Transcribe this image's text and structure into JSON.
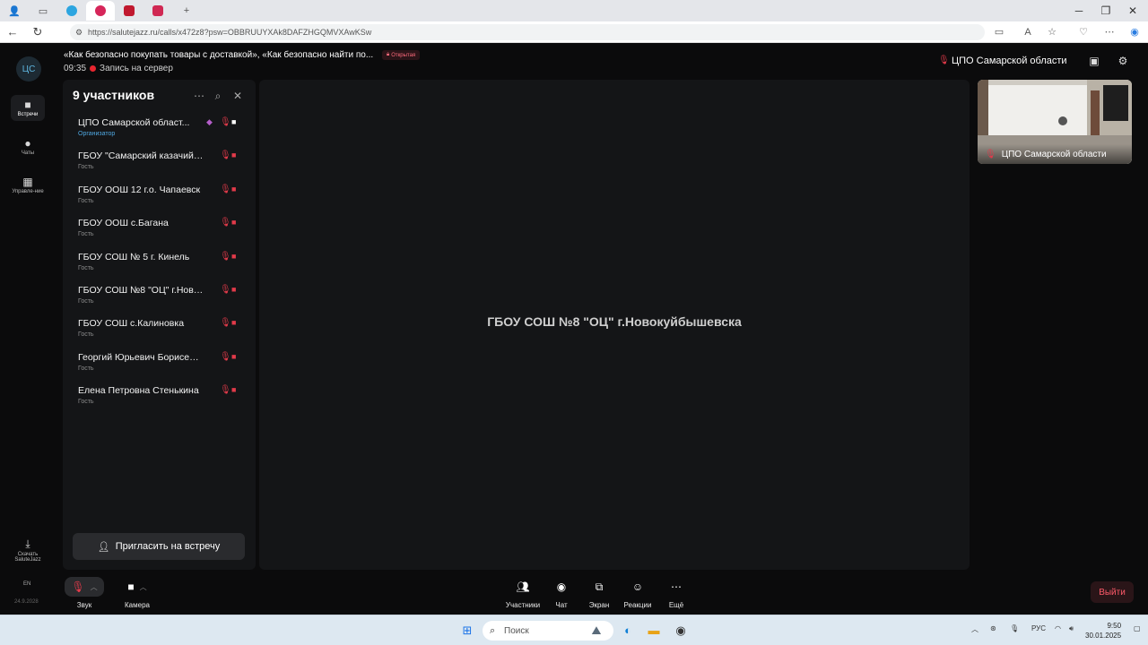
{
  "browser": {
    "url": "https://salutejazz.ru/calls/x472z8?psw=OBBRUUYXAk8DAFZHGQMVXAwKSw"
  },
  "header": {
    "avatar_initials": "ЦС",
    "meeting_title": "«Как безопасно покупать товары с доставкой», «Как безопасно найти по...",
    "open_badge": "Открытая",
    "time": "09:35",
    "recording": "Запись на сервер",
    "organizer_name": "ЦПО Самарской области"
  },
  "rail": {
    "items": [
      {
        "label": "Встречи",
        "icon": "camera-icon",
        "active": true
      },
      {
        "label": "Чаты",
        "icon": "chat-icon",
        "active": false
      },
      {
        "label": "Управле-ние",
        "icon": "chart-icon",
        "active": false
      }
    ],
    "download_label": "Скачать SaluteJazz",
    "lang": "EN",
    "version_date": "24.9.2028"
  },
  "participants": {
    "title": "9 участников",
    "list": [
      {
        "name": "ЦПО Самарской област...",
        "role": "Организатор",
        "organizer": true,
        "cam_on": true
      },
      {
        "name": "ГБОУ \"Самарский казачий ...",
        "role": "Гость",
        "organizer": false,
        "cam_on": false
      },
      {
        "name": "ГБОУ ООШ 12 г.о. Чапаевск",
        "role": "Гость",
        "organizer": false,
        "cam_on": false
      },
      {
        "name": "ГБОУ ООШ с.Багана",
        "role": "Гость",
        "organizer": false,
        "cam_on": false
      },
      {
        "name": "ГБОУ СОШ № 5 г. Кинель",
        "role": "Гость",
        "organizer": false,
        "cam_on": false
      },
      {
        "name": "ГБОУ СОШ №8 \"ОЦ\" г.Ново...",
        "role": "Гость",
        "organizer": false,
        "cam_on": false
      },
      {
        "name": "ГБОУ СОШ с.Калиновка",
        "role": "Гость",
        "organizer": false,
        "cam_on": false
      },
      {
        "name": "Георгий Юрьевич Борисенко",
        "role": "Гость",
        "organizer": false,
        "cam_on": false
      },
      {
        "name": "Елена Петровна Стенькина",
        "role": "Гость",
        "organizer": false,
        "cam_on": false
      }
    ],
    "invite_label": "Пригласить на встречу"
  },
  "stage": {
    "speaker_name": "ГБОУ СОШ №8 \"ОЦ\" г.Новокуйбышевска"
  },
  "thumbnail": {
    "label": "ЦПО Самарской области"
  },
  "controls": {
    "sound": "Звук",
    "camera": "Камера",
    "participants": "Участники",
    "chat": "Чат",
    "screen": "Экран",
    "reactions": "Реакции",
    "more": "Ещё",
    "leave": "Выйти"
  },
  "taskbar": {
    "search_placeholder": "Поиск",
    "lang": "РУС",
    "time": "9:50",
    "date": "30.01.2025"
  },
  "colors": {
    "background": "#0b0b0c",
    "panel": "#141517",
    "danger": "#e23a4a",
    "organizer": "#4fa7e0"
  }
}
